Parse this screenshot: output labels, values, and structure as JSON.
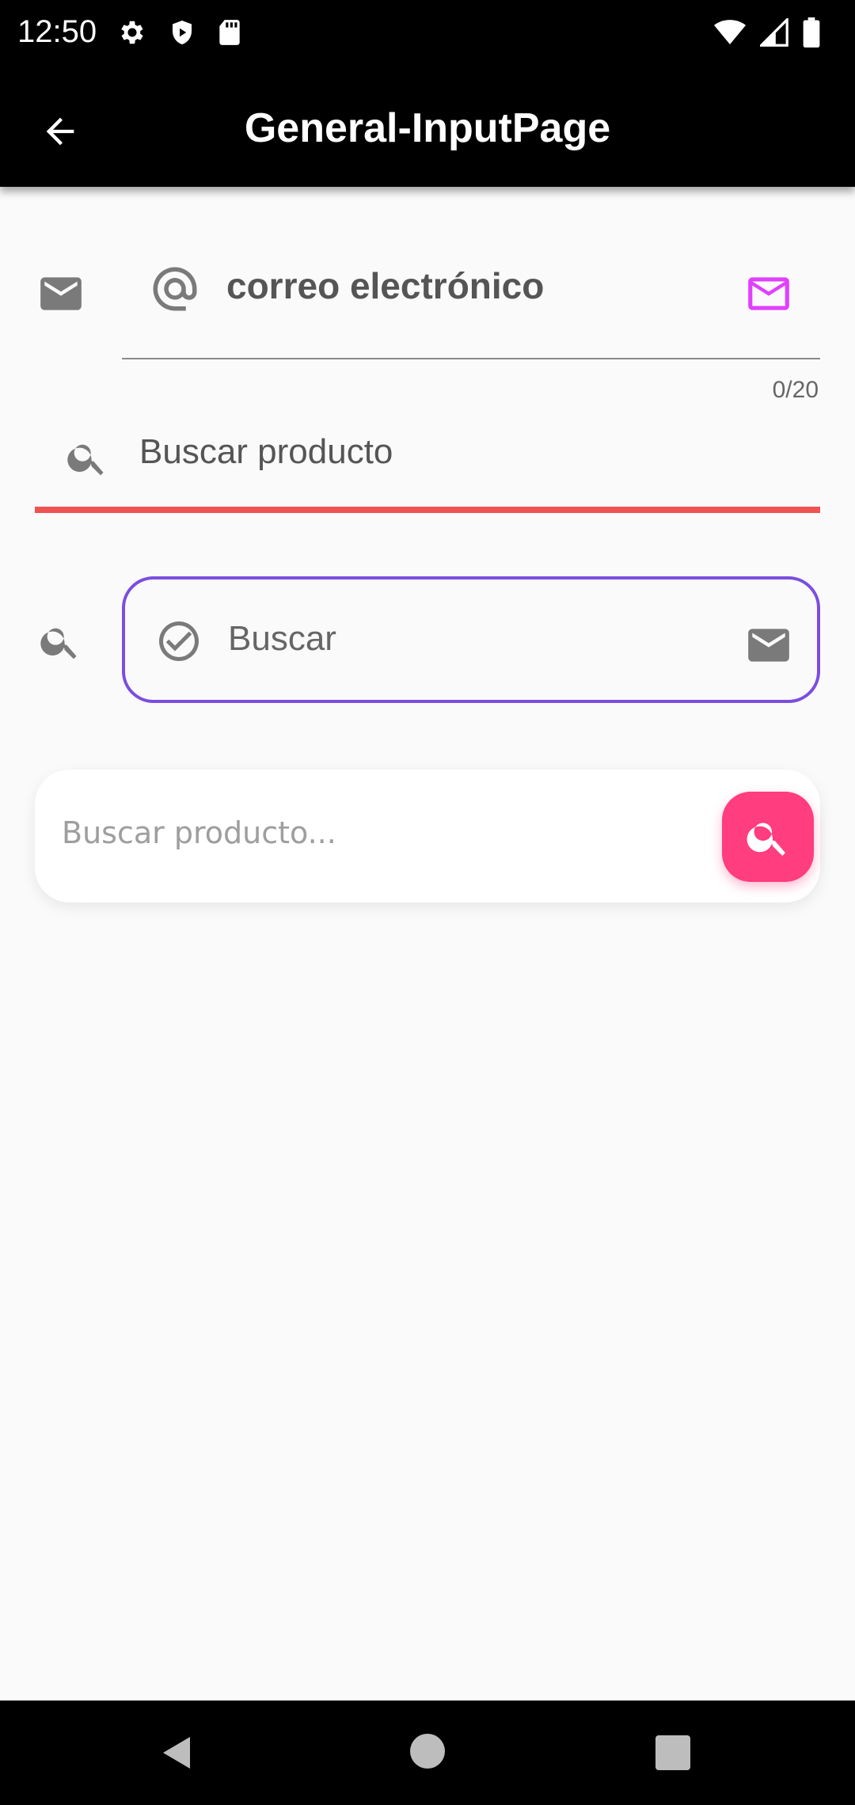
{
  "status_bar": {
    "time": "12:50",
    "left_icons": [
      "settings-icon",
      "shield-play-icon",
      "sd-card-icon"
    ],
    "right_icons": [
      "wifi-icon",
      "cell-signal-icon",
      "battery-icon"
    ]
  },
  "app_bar": {
    "title": "General-InputPage",
    "back_icon": "arrow-back-icon"
  },
  "fields": {
    "email": {
      "prefix_outer_icon": "mail-icon",
      "prefix_icon": "at-sign-icon",
      "value": "correo electrónico",
      "suffix_icon": "mail-outline-icon",
      "counter": "0/20",
      "suffix_color": "#e040fb",
      "underline_color": "#8a8a8a"
    },
    "search_product": {
      "prefix_icon": "search-icon",
      "value": "Buscar producto",
      "underline_color": "#f05252"
    },
    "search_outlined": {
      "prefix_outer_icon": "search-icon",
      "prefix_icon": "check-circle-icon",
      "value": "Buscar",
      "suffix_icon": "mail-icon",
      "border_color": "#7c4ddf"
    },
    "search_card": {
      "placeholder": "Buscar producto...",
      "button_icon": "search-icon",
      "button_color": "#ff3d7f"
    }
  },
  "nav_bar": {
    "buttons": [
      "nav-back-icon",
      "nav-home-icon",
      "nav-recents-icon"
    ]
  }
}
